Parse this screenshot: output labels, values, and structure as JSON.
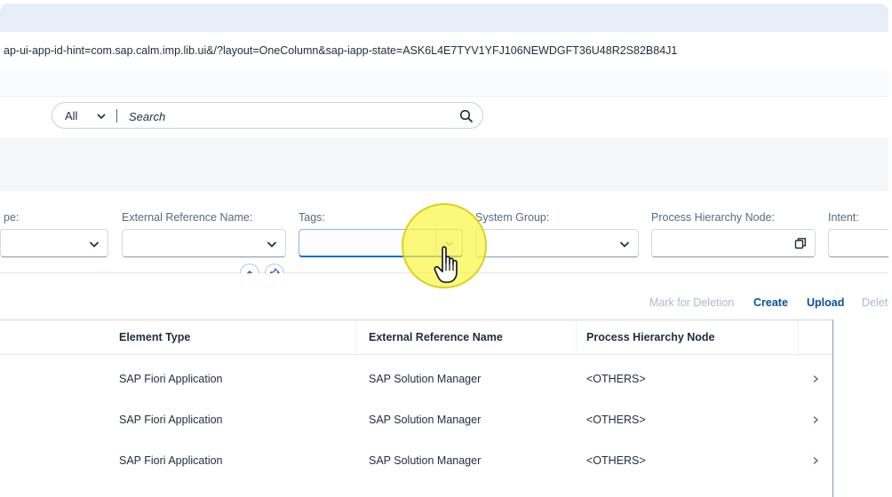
{
  "browser": {
    "url": "ap-ui-app-id-hint=com.sap.calm.imp.lib.ui&/?layout=OneColumn&sap-iapp-state=ASK6L4E7TYV1YFJ106NEWDGFT36U48R2S82B84J1"
  },
  "search": {
    "scope_value": "All",
    "placeholder": "Search",
    "scope_icon": "chevron-down-icon",
    "search_icon": "magnifier-icon"
  },
  "filters": [
    {
      "label": "pe:",
      "value": ""
    },
    {
      "label": "External Reference Name:",
      "value": ""
    },
    {
      "label": "Tags:",
      "value": ""
    },
    {
      "label": "System Group:",
      "value": ""
    },
    {
      "label": "Process Hierarchy Node:",
      "value": ""
    },
    {
      "label": "Intent:",
      "value": ""
    }
  ],
  "filter_controls": {
    "collapse_icon": "chevron-up-icon",
    "pin_icon": "pushpin-icon"
  },
  "toolbar": {
    "mark_for_deletion": "Mark for Deletion",
    "create": "Create",
    "upload": "Upload",
    "delete": "Delete"
  },
  "table": {
    "columns": [
      "Element Type",
      "External Reference Name",
      "Process Hierarchy Node"
    ],
    "rows": [
      {
        "element_type": "SAP Fiori Application",
        "external_reference_name": "SAP Solution Manager",
        "process_hierarchy_node": "<OTHERS>"
      },
      {
        "element_type": "SAP Fiori Application",
        "external_reference_name": "SAP Solution Manager",
        "process_hierarchy_node": "<OTHERS>"
      },
      {
        "element_type": "SAP Fiori Application",
        "external_reference_name": "SAP Solution Manager",
        "process_hierarchy_node": "<OTHERS>"
      }
    ],
    "row_nav_icon": "chevron-right-icon"
  },
  "colors": {
    "accent": "#0a6ed1",
    "link": "#0a4fa0",
    "disabled_link": "#a9bad0",
    "cursor_highlight": "#faf546"
  }
}
